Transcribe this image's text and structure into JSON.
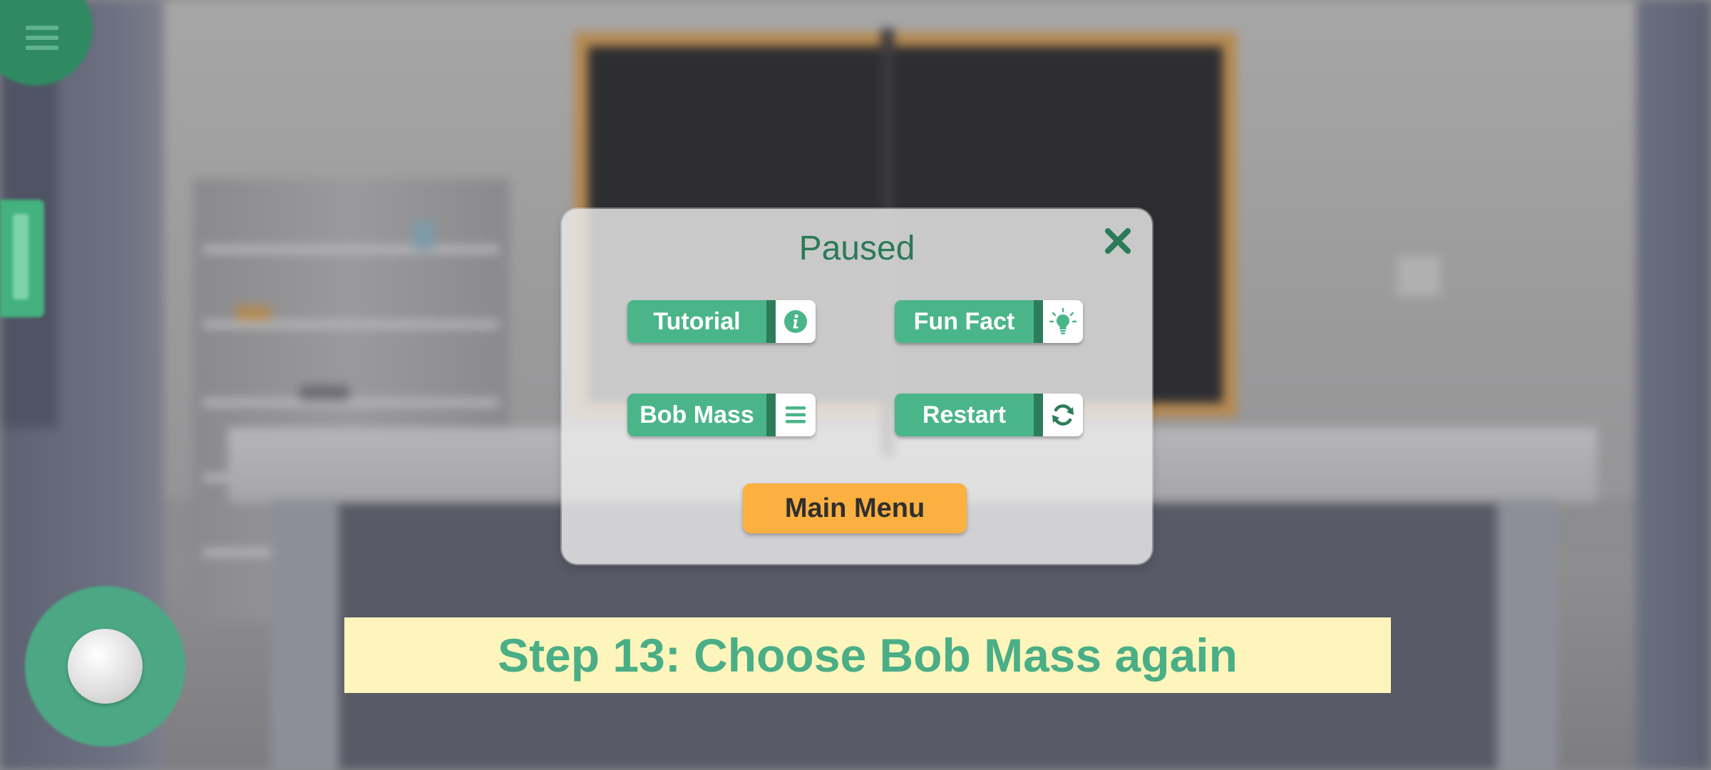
{
  "dialog": {
    "title": "Paused",
    "buttons": [
      {
        "label": "Tutorial",
        "icon": "info-icon"
      },
      {
        "label": "Fun Fact",
        "icon": "lightbulb-icon"
      },
      {
        "label": "Bob Mass",
        "icon": "list-icon"
      },
      {
        "label": "Restart",
        "icon": "refresh-icon"
      }
    ],
    "main_menu_label": "Main Menu",
    "close_icon": "close-icon"
  },
  "banner": {
    "text": "Step 13: Choose Bob Mass again"
  },
  "hud": {
    "menu_icon": "hamburger-menu-icon",
    "joystick": "virtual-joystick"
  },
  "colors": {
    "primary_green": "#4bb58a",
    "dark_green": "#2d7d5b",
    "title_green": "#2b7a59",
    "main_menu_orange": "#fbb040",
    "banner_bg": "#fdf5bb",
    "banner_text": "#4aae86"
  }
}
